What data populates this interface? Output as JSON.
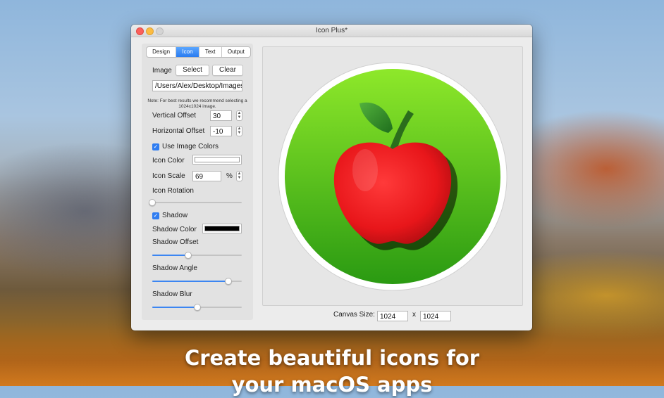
{
  "window": {
    "title": "Icon Plus*"
  },
  "tabs": [
    {
      "label": "Design",
      "active": false
    },
    {
      "label": "Icon",
      "active": true
    },
    {
      "label": "Text",
      "active": false
    },
    {
      "label": "Output",
      "active": false
    }
  ],
  "image": {
    "label": "Image",
    "select_label": "Select",
    "clear_label": "Clear",
    "path": "/Users/Alex/Desktop/Images",
    "note": "Note: For best results we recommend selecting a 1024x1024 image."
  },
  "vertical_offset": {
    "label": "Vertical Offset",
    "value": "30"
  },
  "horizontal_offset": {
    "label": "Horizontal Offset",
    "value": "-10"
  },
  "use_image_colors": {
    "label": "Use Image Colors",
    "checked": true
  },
  "icon_color": {
    "label": "Icon Color",
    "color": "#ffffff"
  },
  "icon_scale": {
    "label": "Icon Scale",
    "value": "69",
    "unit": "%"
  },
  "icon_rotation": {
    "label": "Icon Rotation",
    "level": 0.0
  },
  "shadow": {
    "label": "Shadow",
    "checked": true
  },
  "shadow_color": {
    "label": "Shadow Color",
    "color": "#000000"
  },
  "shadow_offset": {
    "label": "Shadow Offset",
    "level": 0.4
  },
  "shadow_angle": {
    "label": "Shadow Angle",
    "level": 0.85
  },
  "shadow_blur": {
    "label": "Shadow Blur",
    "level": 0.5
  },
  "canvas_size": {
    "label": "Canvas Size:",
    "width": "1024",
    "separator": "x",
    "height": "1024"
  },
  "colors": {
    "accent": "#2f7df1",
    "circle_green_top": "#8ee82a",
    "circle_green_bottom": "#2a9a12",
    "apple_red": "#e8161a",
    "leaf_green": "#2e8a2a"
  },
  "tagline": "Create beautiful icons for\nyour macOS apps"
}
